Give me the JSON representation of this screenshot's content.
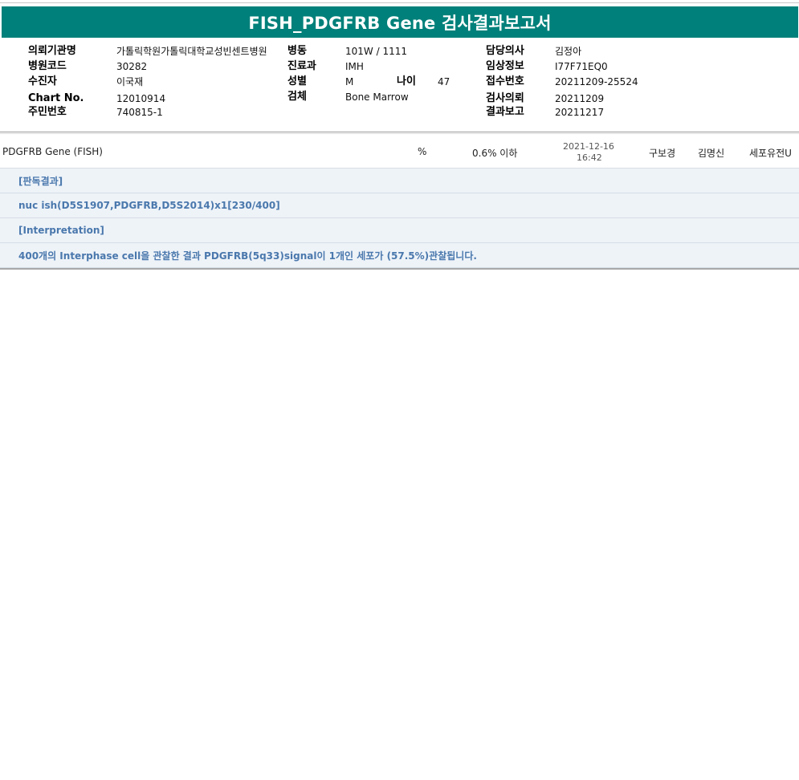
{
  "report": {
    "title": "FISH_PDGFRB Gene 검사결과보고서"
  },
  "patient_info": {
    "institution": {
      "label": "의뢰기관명",
      "value": "가톨릭학원가톨릭대학교성빈센트병원"
    },
    "hospital_code": {
      "label": "병원코드",
      "value": "30282"
    },
    "patient_name": {
      "label": "수진자",
      "value": "이국재"
    },
    "chart_no": {
      "label": "Chart No.",
      "value": "12010914"
    },
    "resident_no": {
      "label": "주민번호",
      "value": "740815-1"
    },
    "ward": {
      "label": "병동",
      "value": "101W / 1111"
    },
    "department": {
      "label": "진료과",
      "value": "IMH"
    },
    "sex": {
      "label": "성별",
      "value": "M"
    },
    "age": {
      "label": "나이",
      "value": "47"
    },
    "specimen": {
      "label": "검체",
      "value": "Bone Marrow"
    },
    "doctor": {
      "label": "담당의사",
      "value": "김정아"
    },
    "clinical_info": {
      "label": "임상정보",
      "value": "I77F71EQ0"
    },
    "receipt_no": {
      "label": "접수번호",
      "value": "20211209-25524"
    },
    "request_date": {
      "label": "검사의뢰",
      "value": "20211209"
    },
    "report_date": {
      "label": "결과보고",
      "value": "20211217"
    }
  },
  "result": {
    "test_name": "PDGFRB Gene (FISH)",
    "unit": "%",
    "reference": "0.6% 이하",
    "date": "2021-12-16",
    "time": "16:42",
    "reporter": "구보경",
    "verifier": "김명신",
    "department": "세포유전U"
  },
  "interpretation": [
    "[판독결과]",
    "nuc ish(D5S1907,PDGFRB,D5S2014)x1[230/400]",
    "[Interpretation]",
    "400개의 Interphase cell을 관찰한 결과 PDGFRB(5q33)signal이 1개인 세포가 (57.5%)관찰됩니다."
  ]
}
